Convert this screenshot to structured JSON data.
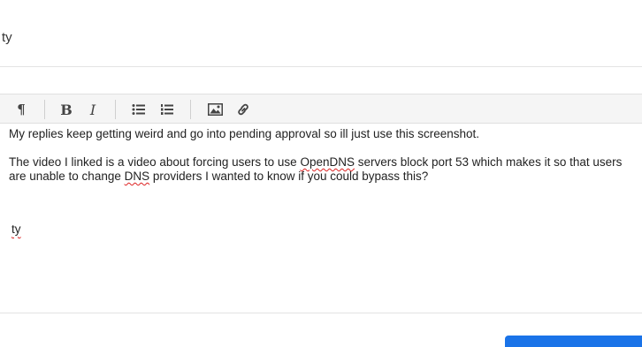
{
  "title_field": {
    "value": "ty"
  },
  "toolbar": {
    "paragraph_icon": "¶",
    "bold_icon": "B",
    "italic_icon": "I",
    "items": [
      "paragraph-icon",
      "bold-icon",
      "italic-icon",
      "bullet-list-icon",
      "numbered-list-icon",
      "image-icon",
      "link-icon"
    ]
  },
  "editor": {
    "line1": "My replies keep getting weird and go into pending approval so ill just use this screenshot.",
    "p2_before": "The video I linked is a video about forcing users to use ",
    "p2_opendns": "OpenDNS",
    "p2_middle": " servers block port 53 which makes it so that users are unable to change ",
    "p2_dns": "DNS",
    "p2_after": " providers I wanted to know if you could bypass this?",
    "signature": "ty"
  },
  "colors": {
    "accent": "#1a73e8",
    "toolbar_bg": "#f5f5f5",
    "spellcheck": "#dd2222"
  }
}
